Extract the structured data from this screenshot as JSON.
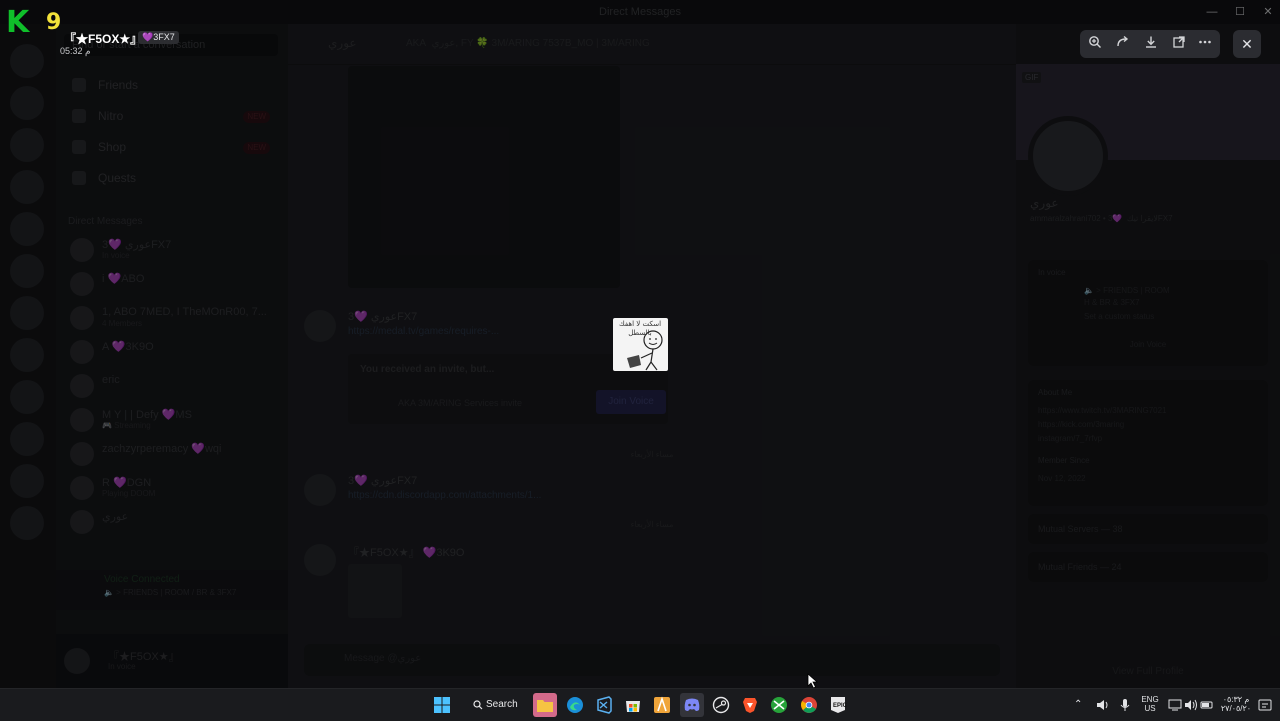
{
  "window": {
    "title": "Direct Messages",
    "controls": [
      "minimize",
      "maximize",
      "close"
    ]
  },
  "watermark": {
    "letter": "K",
    "number": "9"
  },
  "uploader": {
    "name": "『★F5OX★』",
    "tag": "💜3FX7",
    "time": "05:32 م"
  },
  "viewer_toolbar": {
    "icons": [
      "zoom-in-icon",
      "forward-icon",
      "download-icon",
      "open-external-icon",
      "more-icon"
    ],
    "close_label": "✕"
  },
  "sidebar": {
    "search_placeholder": "Find or start a conversation",
    "nav": [
      {
        "label": "Friends",
        "badge": ""
      },
      {
        "label": "Nitro",
        "badge": "NEW"
      },
      {
        "label": "Shop",
        "badge": "NEW"
      },
      {
        "label": "Quests",
        "badge": ""
      }
    ],
    "dm_header": "Direct Messages",
    "dms": [
      {
        "name": "عوري",
        "tag": "💜3FX7",
        "sub": "In voice"
      },
      {
        "name": "i",
        "tag": "💜ABO",
        "sub": ""
      },
      {
        "name": "1, ABO 7MED, I TheMOnR00, 7...",
        "tag": "",
        "sub": "4 Members"
      },
      {
        "name": "A",
        "tag": "💜3K9O",
        "sub": ""
      },
      {
        "name": "eric",
        "tag": "",
        "sub": ""
      },
      {
        "name": "M Y | | Defy",
        "tag": "💜MS",
        "sub": "🎮 Streaming"
      },
      {
        "name": "zachzyrperemacy",
        "tag": "💜wqi",
        "sub": ""
      },
      {
        "name": "R",
        "tag": "💜DGN",
        "sub": "Playing DOOM"
      },
      {
        "name": "عوري",
        "tag": "",
        "sub": ""
      }
    ],
    "voice": {
      "status": "Voice Connected",
      "channel": "🔈 > FRIENDS | ROOM / BR & 3FX7"
    },
    "user": {
      "name": "『★F5OX★』",
      "status": "In voice"
    }
  },
  "chat": {
    "header_name": "عوري",
    "header_aka": "AKA",
    "header_aka_names": "عوري, FY 🍀 3M/ARING 7537B_MO | 3M/ARING",
    "messages": [
      {
        "name": "عوري",
        "tag": "💜3FX7",
        "line": "https://medal.tv/games/requires-..."
      },
      {
        "name": "عوري",
        "tag": "💜3FX7",
        "line": "https://cdn.discordapp.com/attachments/1..."
      },
      {
        "name": "『★F5OX★』",
        "tag": "💜3K9O",
        "line": ""
      }
    ],
    "invite": {
      "label": "You received an invite, but...",
      "channel": "AKA 3M/ARING Services invite",
      "button": "Join Voice"
    },
    "dividers": [
      "مساء الأربعاء",
      "مساء الأربعاء"
    ],
    "input_placeholder": "Message @عوري"
  },
  "profile": {
    "gif_badge": "GIF",
    "name": "عوري",
    "username": "ammaralzahrani702 • لايقرا تيك",
    "tag": "💜3FX7",
    "in_voice": {
      "label": "In voice",
      "channel": "🔈 > FRIENDS | ROOM",
      "server": "H & BR & 3FX7",
      "custom_status": "Set a custom status"
    },
    "join_voice": "Join Voice",
    "about_me_label": "About Me",
    "links": [
      "https://www.twitch.tv/3MARING7021",
      "https://kick.com/3maring",
      "instagram/7_7rfvp"
    ],
    "member_since_label": "Member Since",
    "member_since": "Nov 12, 2022",
    "mutual_servers": "Mutual Servers — 38",
    "mutual_friends": "Mutual Friends — 24",
    "view_full": "View Full Profile"
  },
  "sticker": {
    "text": "اسكت لا اهفك بالسطل"
  },
  "taskbar": {
    "search_label": "Search",
    "lang": "ENG",
    "region": "US",
    "clock_time": "م ٠٥:٣٢",
    "clock_date": "٢٧/٠٥/٢٠"
  }
}
